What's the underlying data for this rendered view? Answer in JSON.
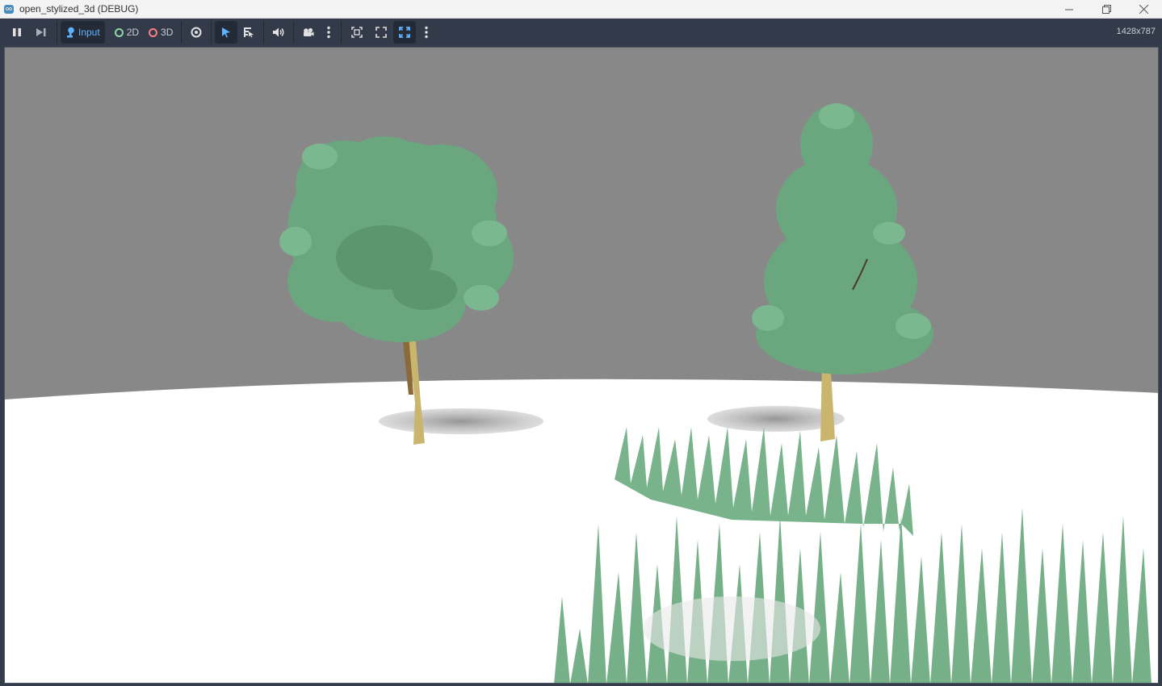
{
  "window": {
    "title": "open_stylized_3d (DEBUG)",
    "icon": "godot-icon"
  },
  "window_controls": {
    "minimize": "minimize-icon",
    "restore": "restore-icon",
    "close": "close-icon"
  },
  "toolbar": {
    "input_label": "Input",
    "mode_2d_label": "2D",
    "mode_3d_label": "3D",
    "resolution": "1428x787"
  },
  "colors": {
    "accent": "#5fb2ff",
    "sky": "#888888",
    "ground": "#ffffff",
    "foliage": "#6aa67e",
    "ring_2d": "#8ed6a5",
    "ring_3d": "#fc7f7f"
  }
}
